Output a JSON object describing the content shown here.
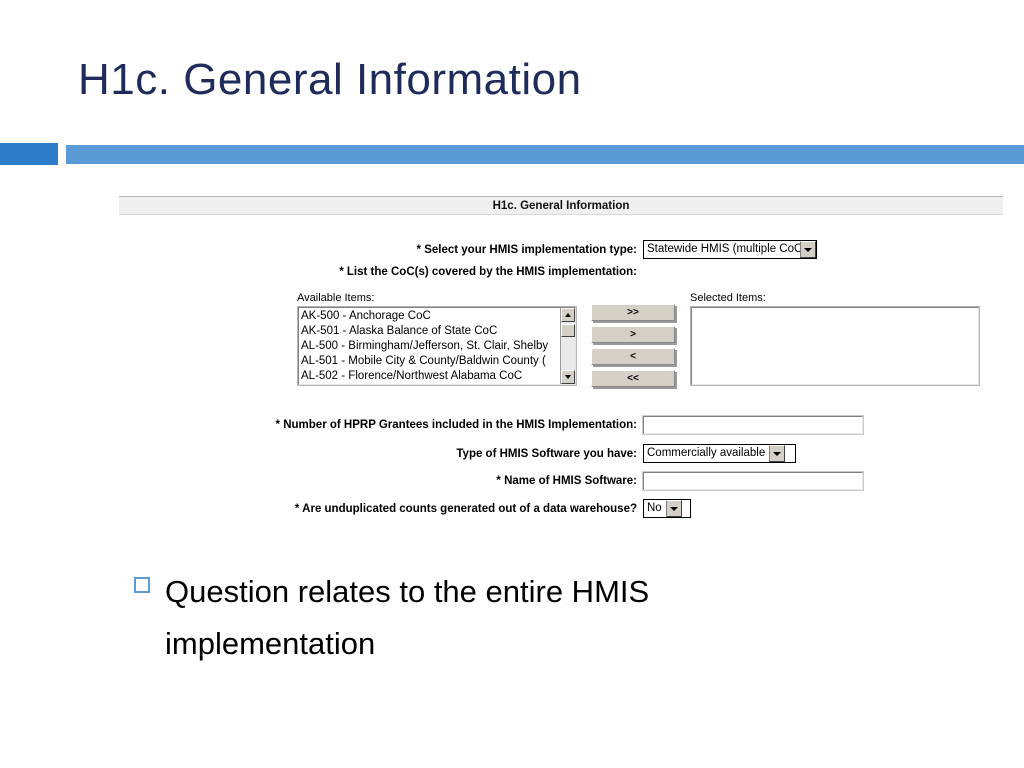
{
  "slide": {
    "title": "H1c. General Information",
    "accent_left_color": "#2E7BC8",
    "accent_right_color": "#5B9BD5",
    "title_color": "#1F2B5B"
  },
  "form": {
    "header_title": "H1c. General Information",
    "implementation_type": {
      "label": "* Select your HMIS implementation type:",
      "value": "Statewide HMIS (multiple CoC)"
    },
    "coc_list": {
      "label": "* List the CoC(s) covered by the HMIS implementation:",
      "available_caption": "Available Items:",
      "selected_caption": "Selected Items:",
      "available_items": [
        "AK-500 - Anchorage CoC",
        "AK-501 - Alaska Balance of State CoC",
        "AL-500 - Birmingham/Jefferson, St. Clair, Shelby",
        "AL-501 - Mobile City & County/Baldwin County (",
        "AL-502 - Florence/Northwest Alabama CoC"
      ],
      "selected_items": [],
      "buttons": [
        {
          "name": "move-all-right",
          "label": ">>"
        },
        {
          "name": "move-right",
          "label": ">"
        },
        {
          "name": "move-left",
          "label": "<"
        },
        {
          "name": "move-all-left",
          "label": "<<"
        }
      ]
    },
    "hprp_grantees": {
      "label": "* Number of HPRP Grantees included in the HMIS Implementation:",
      "value": "",
      "placeholder": ""
    },
    "software_type": {
      "label": "Type of HMIS Software you have:",
      "value": "Commercially available"
    },
    "software_name": {
      "label": "* Name of HMIS Software:",
      "value": "",
      "placeholder": ""
    },
    "data_warehouse": {
      "label": "* Are unduplicated counts generated out of a data warehouse?",
      "value": "No"
    }
  },
  "bullets": [
    {
      "text": "Question relates to the entire HMIS implementation"
    }
  ]
}
